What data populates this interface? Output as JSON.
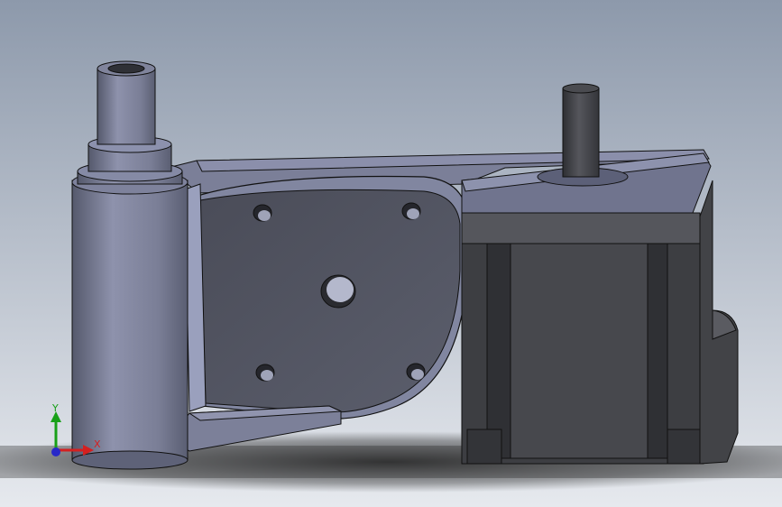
{
  "viewport": {
    "background_top": "#8d99ab",
    "background_bottom": "#e6e9ee"
  },
  "model": {
    "colors": {
      "body_light": "#8a8ea8",
      "body_mid": "#6a6e84",
      "body_dark": "#45474f",
      "motor_dark": "#3c3d40",
      "motor_mid": "#505155",
      "edge": "#111111",
      "hole": "#1e1e22"
    }
  },
  "triad": {
    "x_label": "X",
    "y_label": "Y",
    "x_color": "#d42020",
    "y_color": "#18a018",
    "z_color": "#2828c8"
  }
}
